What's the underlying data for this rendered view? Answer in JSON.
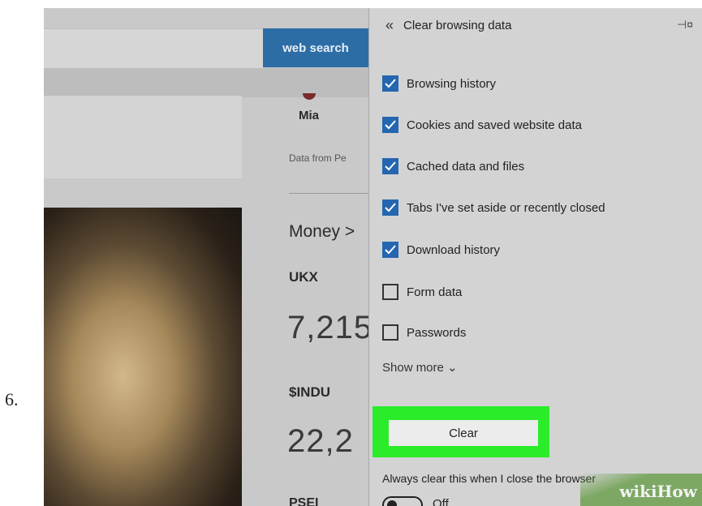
{
  "step": {
    "number": "6."
  },
  "browser": {
    "web_search_label": "web search"
  },
  "news_feed": {
    "profile_name": "Mia",
    "data_from": "Data from Pe",
    "money_label": "Money >",
    "ticker1_symbol": "UKX",
    "ticker1_value": "7,215",
    "ticker2_symbol": "$INDU",
    "ticker2_value": "22,2",
    "ticker3_symbol": "PSEI"
  },
  "panel": {
    "title": "Clear browsing data",
    "back_icon": "double-chevron-left-icon",
    "pin_icon": "pin-icon",
    "options": [
      {
        "label": "Browsing history",
        "checked": true
      },
      {
        "label": "Cookies and saved website data",
        "checked": true
      },
      {
        "label": "Cached data and files",
        "checked": true
      },
      {
        "label": "Tabs I've set aside or recently closed",
        "checked": true
      },
      {
        "label": "Download history",
        "checked": true
      },
      {
        "label": "Form data",
        "checked": false
      },
      {
        "label": "Passwords",
        "checked": false
      }
    ],
    "show_more": "Show more ⌄",
    "clear_button": "Clear",
    "always_clear_label": "Always clear this when I close the browser",
    "toggle_state": "Off"
  },
  "colors": {
    "checkbox_on": "#2466b0",
    "highlight": "#2bec2b",
    "web_search_bg": "#2d6da6"
  },
  "watermark": {
    "text": "wikiHow"
  }
}
